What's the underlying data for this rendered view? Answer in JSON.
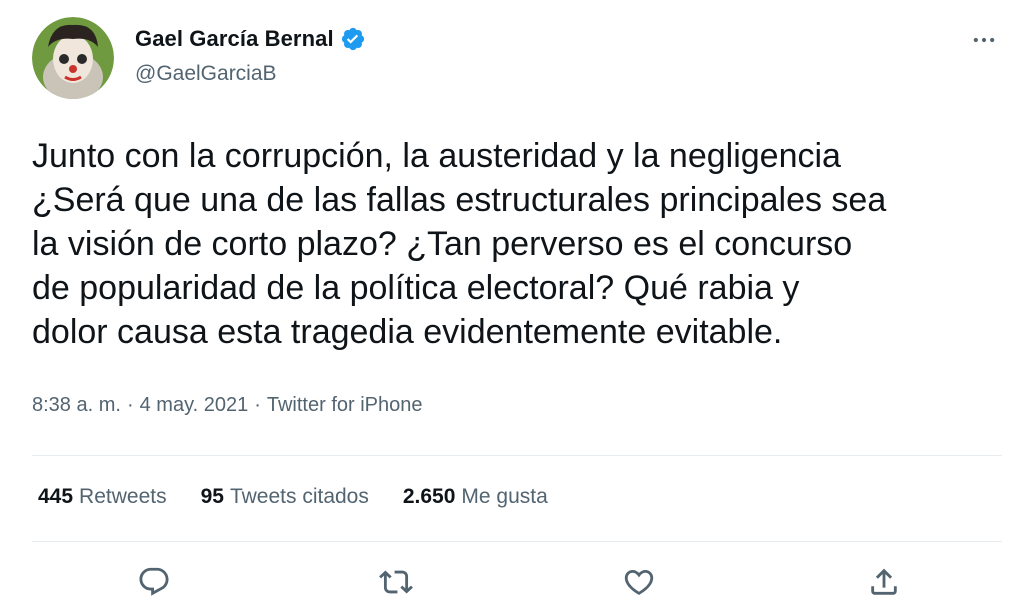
{
  "author": {
    "display_name": "Gael García Bernal",
    "handle": "@GaelGarciaB",
    "verified": true,
    "avatar_icon": "avatar-icon"
  },
  "tweet": {
    "text": "Junto con la corrupción, la austeridad y la negligencia\n¿Será que una de las fallas estructurales principales sea\nla visión de corto plazo? ¿Tan perverso es el concurso\nde popularidad de la política electoral? Qué rabia y\ndolor causa esta tragedia evidentemente evitable.",
    "time": "8:38 a. m.",
    "separator": "·",
    "date": "4 may. 2021",
    "source": "Twitter for iPhone"
  },
  "stats": {
    "retweets_count": "445",
    "retweets_label": "Retweets",
    "quotes_count": "95",
    "quotes_label": "Tweets citados",
    "likes_count": "2.650",
    "likes_label": "Me gusta"
  },
  "actions": [
    {
      "icon": "reply-icon"
    },
    {
      "icon": "retweet-icon"
    },
    {
      "icon": "like-icon"
    },
    {
      "icon": "share-icon"
    }
  ],
  "colors": {
    "text_primary": "#0f1419",
    "text_secondary": "#536471",
    "verified_blue": "#1d9bf0",
    "divider": "#e6ecf0"
  }
}
